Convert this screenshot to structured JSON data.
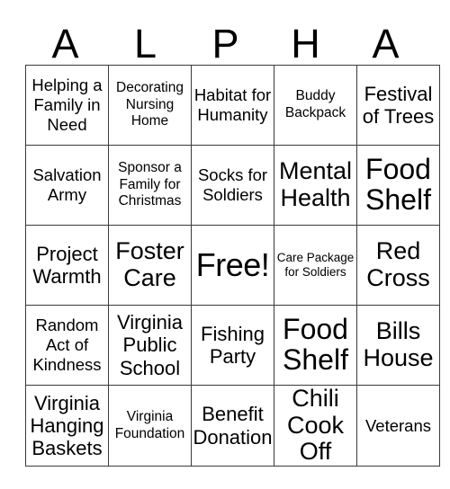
{
  "card": {
    "header_letters": [
      "A",
      "L",
      "P",
      "H",
      "A"
    ],
    "rows": [
      [
        {
          "text": "Helping a Family in Need",
          "size": "md"
        },
        {
          "text": "Decorating Nursing Home",
          "size": "sm"
        },
        {
          "text": "Habitat for Humanity",
          "size": "md"
        },
        {
          "text": "Buddy Backpack",
          "size": "sm"
        },
        {
          "text": "Festival of Trees",
          "size": "lg"
        }
      ],
      [
        {
          "text": "Salvation Army",
          "size": "md"
        },
        {
          "text": "Sponsor a Family for Christmas",
          "size": "sm"
        },
        {
          "text": "Socks for Soldiers",
          "size": "md"
        },
        {
          "text": "Mental Health",
          "size": "xl"
        },
        {
          "text": "Food Shelf",
          "size": "xxl"
        }
      ],
      [
        {
          "text": "Project Warmth",
          "size": "lg"
        },
        {
          "text": "Foster Care",
          "size": "xl"
        },
        {
          "text": "Free!",
          "size": "free"
        },
        {
          "text": "Care Package for Soldiers",
          "size": "xs"
        },
        {
          "text": "Red Cross",
          "size": "xl"
        }
      ],
      [
        {
          "text": "Random Act of Kindness",
          "size": "md"
        },
        {
          "text": "Virginia Public School",
          "size": "lg"
        },
        {
          "text": "Fishing Party",
          "size": "lg"
        },
        {
          "text": "Food Shelf",
          "size": "xxl"
        },
        {
          "text": "Bills House",
          "size": "xl"
        }
      ],
      [
        {
          "text": "Virginia Hanging Baskets",
          "size": "lg"
        },
        {
          "text": "Virginia Foundation",
          "size": "sm"
        },
        {
          "text": "Benefit Donation",
          "size": "lg"
        },
        {
          "text": "Chili Cook Off",
          "size": "xl"
        },
        {
          "text": "Veterans",
          "size": "md"
        }
      ]
    ],
    "free_space": {
      "row": 2,
      "col": 2
    },
    "colors": {
      "text": "#000000",
      "border": "#3a3a3a",
      "background": "#ffffff"
    }
  }
}
